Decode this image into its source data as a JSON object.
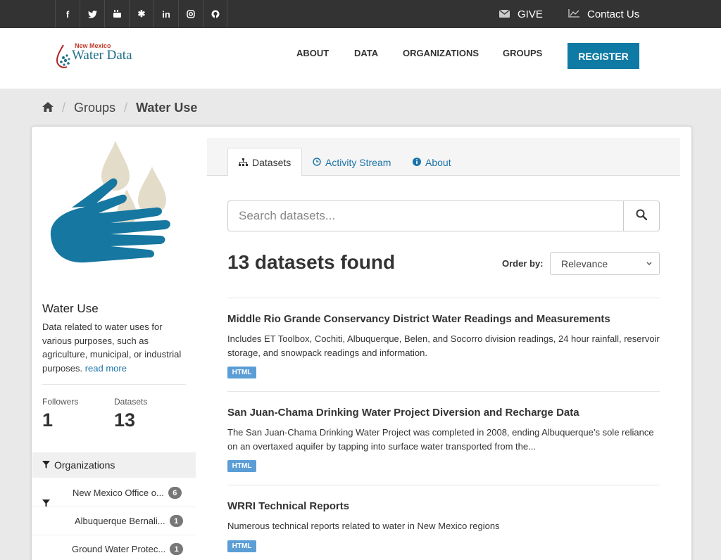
{
  "topbar": {
    "social_icons": [
      "facebook-icon",
      "twitter-icon",
      "youtube-icon",
      "slack-icon",
      "linkedin-icon",
      "instagram-icon",
      "github-icon"
    ],
    "social_glyphs": [
      "f",
      "🐦",
      "▶",
      "✱",
      "in",
      "◎",
      "◔"
    ],
    "give_label": "GIVE",
    "contact_label": "Contact Us"
  },
  "header": {
    "logo_small": "New Mexico",
    "logo_big": "Water Data",
    "nav": [
      "ABOUT",
      "DATA",
      "ORGANIZATIONS",
      "GROUPS"
    ],
    "register_label": "REGISTER"
  },
  "breadcrumb": {
    "items": [
      "Groups",
      "Water Use"
    ]
  },
  "group": {
    "title": "Water Use",
    "description": "Data related to water uses for various purposes, such as agriculture, municipal, or industrial purposes.",
    "read_more": "read more",
    "followers_label": "Followers",
    "followers_count": "1",
    "datasets_label": "Datasets",
    "datasets_count": "13"
  },
  "facets": {
    "organizations_label": "Organizations",
    "items": [
      {
        "label": "New Mexico Office o...",
        "count": "6"
      },
      {
        "label": "Albuquerque Bernali...",
        "count": "1"
      },
      {
        "label": "Ground Water Protec...",
        "count": "1"
      }
    ]
  },
  "tabs": [
    {
      "label": "Datasets",
      "icon": "sitemap-icon"
    },
    {
      "label": "Activity Stream",
      "icon": "clock-icon"
    },
    {
      "label": "About",
      "icon": "info-icon"
    }
  ],
  "search": {
    "placeholder": "Search datasets...",
    "value": ""
  },
  "results": {
    "found_label": "13 datasets found",
    "order_by_label": "Order by:",
    "order_by_value": "Relevance",
    "datasets": [
      {
        "title": "Middle Rio Grande Conservancy District Water Readings and Measurements",
        "description": "Includes ET Toolbox, Cochiti, Albuquerque, Belen, and Socorro division readings, 24 hour rainfall, reservoir storage, and snowpack readings and information.",
        "format": "HTML"
      },
      {
        "title": "San Juan-Chama Drinking Water Project Diversion and Recharge Data",
        "description": "The San Juan-Chama Drinking Water Project was completed in 2008, ending Albuquerque’s sole reliance on an overtaxed aquifer by tapping into surface water transported from the...",
        "format": "HTML"
      },
      {
        "title": "WRRI Technical Reports",
        "description": "Numerous technical reports related to water in New Mexico regions",
        "format": "HTML"
      }
    ]
  },
  "colors": {
    "topbar": "#333333",
    "accent": "#0f7aa3",
    "link": "#1a73a8",
    "tag": "#5b9ed6",
    "hand": "#1677a0",
    "drop": "#e3dcc8"
  }
}
